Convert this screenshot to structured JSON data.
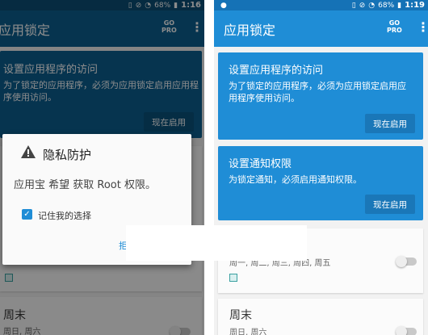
{
  "left": {
    "status": {
      "battery": "68%",
      "time": "1:16"
    },
    "app_title": "应用锁定",
    "gopro_line1": "GO",
    "gopro_line2": "PRO",
    "card_access": {
      "title": "设置应用程序的访问",
      "desc": "为了锁定的应用程序，必须为应用锁定启用应用程序使用访问。",
      "button": "现在启用"
    },
    "weekend": {
      "title": "周末",
      "days": "周日, 周六"
    },
    "dialog": {
      "title": "隐私防护",
      "message": "应用宝 希望 获取 Root 权限。",
      "remember": "记住我的选择",
      "button": "拒"
    }
  },
  "right": {
    "status": {
      "battery": "68%",
      "time": "1:19"
    },
    "app_title": "应用锁定",
    "gopro_line1": "GO",
    "gopro_line2": "PRO",
    "card_access": {
      "title": "设置应用程序的访问",
      "desc": "为了锁定的应用程序，必须为应用锁定启用应用程序使用访问。",
      "button": "现在启用"
    },
    "card_notify": {
      "title": "设置通知权限",
      "desc": "为锁定通知，必须启用通知权限。",
      "button": "现在启用"
    },
    "workday": {
      "days": "周一, 周二, 周三, 周四, 周五"
    },
    "weekend": {
      "title": "周末",
      "days": "周日, 周六"
    }
  },
  "colors": {
    "accent": "#1f8dd6",
    "dim_accent": "#0b5f91"
  }
}
